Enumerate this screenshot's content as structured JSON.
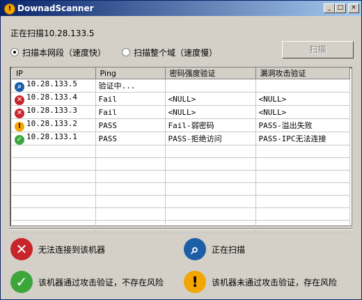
{
  "window": {
    "title": "DownadScanner",
    "minimize": "_",
    "maximize": "□",
    "close": "×"
  },
  "scan_status": "正在扫描10.28.133.5",
  "options": {
    "local_segment": "扫描本网段（速度快）",
    "whole_domain": "扫描整个域（速度慢）",
    "selected": "local_segment"
  },
  "scan_button": "扫描",
  "table": {
    "columns": [
      "IP",
      "Ping",
      "密码强度验证",
      "漏洞攻击验证"
    ],
    "rows": [
      {
        "icon": "magnifier-icon",
        "ip": "10.28.133.5",
        "ping": "验证中...",
        "pwd": "",
        "vuln": ""
      },
      {
        "icon": "red-x-icon",
        "ip": "10.28.133.4",
        "ping": "Fail",
        "pwd": "<NULL>",
        "vuln": "<NULL>"
      },
      {
        "icon": "red-x-icon",
        "ip": "10.28.133.3",
        "ping": "Fail",
        "pwd": "<NULL>",
        "vuln": "<NULL>"
      },
      {
        "icon": "warning-icon",
        "ip": "10.28.133.2",
        "ping": "PASS",
        "pwd": "Fail-弱密码",
        "vuln": "PASS-溢出失败"
      },
      {
        "icon": "green-check-icon",
        "ip": "10.28.133.1",
        "ping": "PASS",
        "pwd": "PASS-拒绝访问",
        "vuln": "PASS-IPC无法连接"
      }
    ]
  },
  "legend": {
    "cannot_connect": "无法连接到该机器",
    "scanning": "正在扫描",
    "passed": "该机器通过攻击验证，不存在风险",
    "not_passed": "该机器未通过攻击验证，存在风险"
  },
  "colors": {
    "fail": "#c8242b",
    "scan": "#1d5fa6",
    "ok": "#3ca63c",
    "warn": "#f3a500",
    "titlebar": "#0a246a"
  }
}
